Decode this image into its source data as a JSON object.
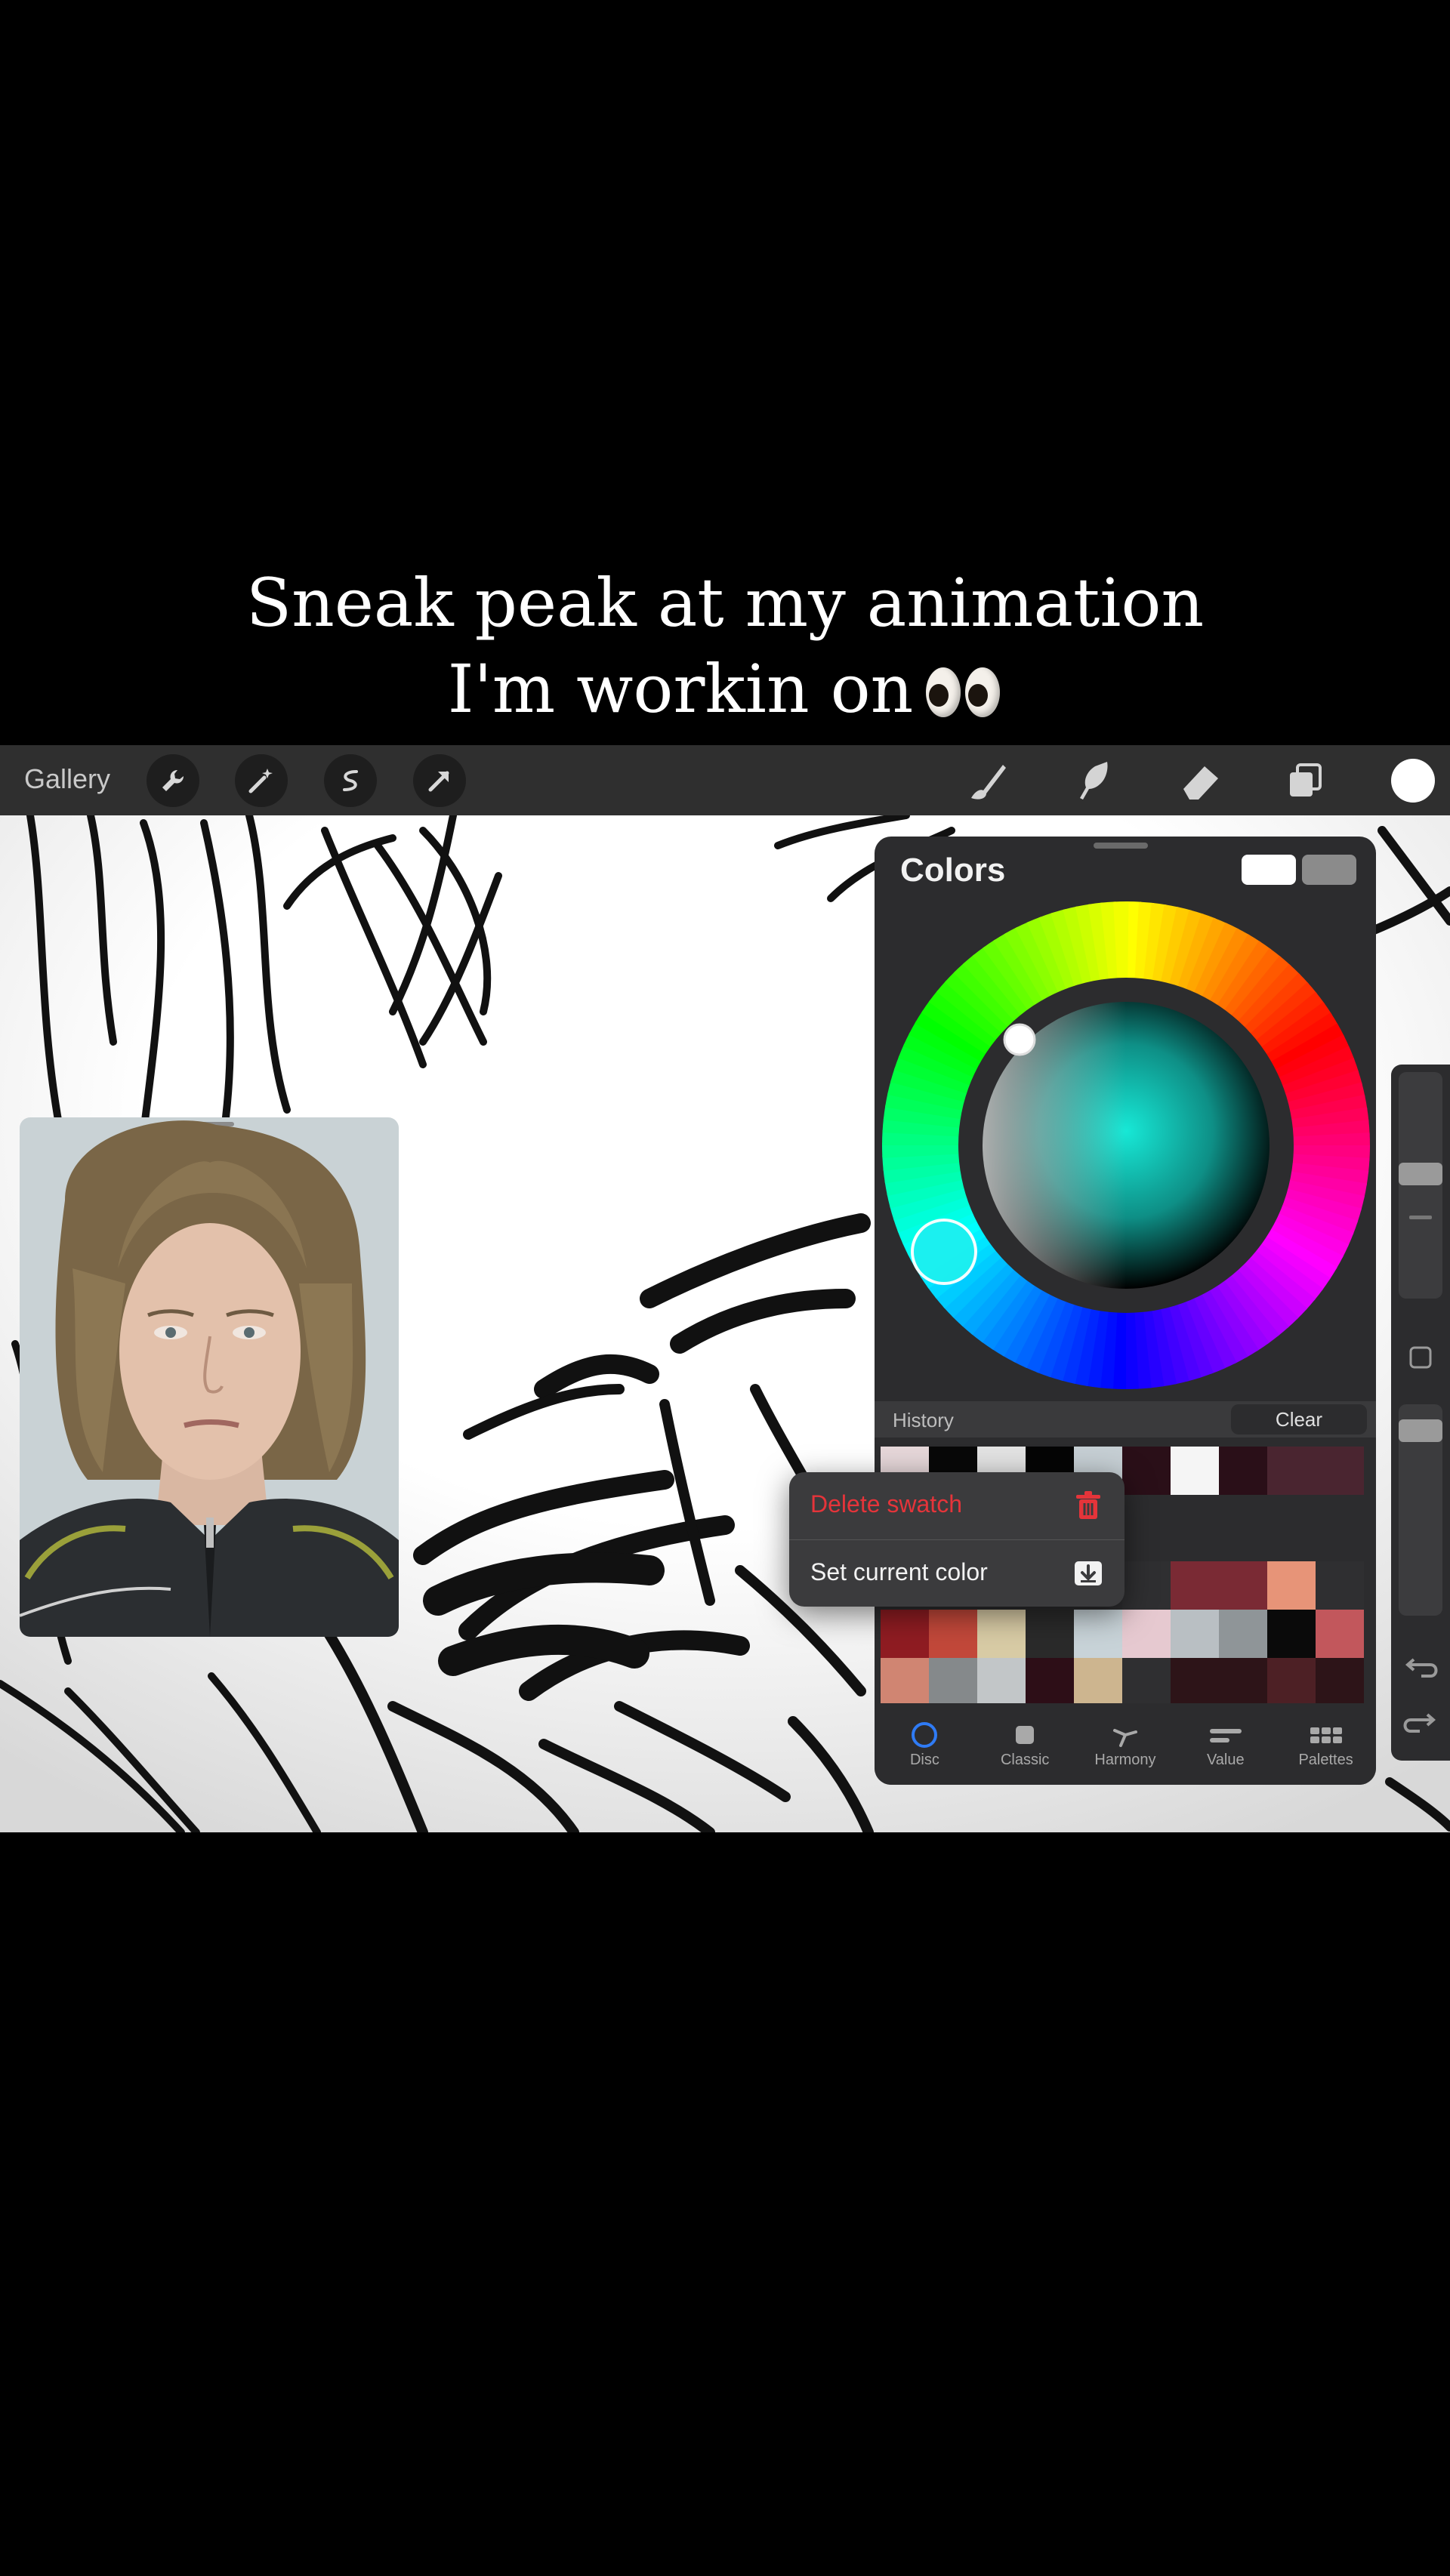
{
  "caption": {
    "line1": "Sneak peak at my animation",
    "line2": "I'm workin on"
  },
  "toolbar": {
    "gallery_label": "Gallery",
    "left_icons": [
      "wrench-icon",
      "magic-wand-icon",
      "selection-icon",
      "arrow-transform-icon"
    ],
    "right_icons": [
      "brush-icon",
      "smudge-icon",
      "eraser-icon",
      "layers-icon"
    ],
    "current_color": "#ffffff"
  },
  "colors_panel": {
    "title": "Colors",
    "current_swatch": "#ffffff",
    "previous_swatch": "#8b8b8b",
    "selected_hue": "#17e8d6",
    "history_label": "History",
    "clear_label": "Clear",
    "history_colors": [
      "#e6d7d9",
      "#080808",
      "#e3e3e3",
      "#050505",
      "#c6cfd4",
      "#2a0f18",
      "#f5f5f5",
      "#2a0f18",
      "#4a2530",
      "#4a2530"
    ],
    "palette_colors": [
      "#2c2c2e",
      "#2c2c2e",
      "#2c2c2e",
      "#2c2c2e",
      "#2c2c2e",
      "#2f2f31",
      "#7a2a34",
      "#7a2a34",
      "#e79478",
      "#2f2f31",
      "#8f1c22",
      "#c2483a",
      "#d8cba5",
      "#2a2a2a",
      "#c8d3d8",
      "#e6c9d0",
      "#b9bfc3",
      "#8f9598",
      "#0a0a0a",
      "#c2575c",
      "#d08572",
      "#85898b",
      "#c2c6c8",
      "#2d0e17",
      "#cdb58f",
      "#2f2f31",
      "#2d1418",
      "#2d1418",
      "#4d2025",
      "#2d1418"
    ],
    "tabs": [
      {
        "label": "Disc",
        "icon": "disc-icon"
      },
      {
        "label": "Classic",
        "icon": "classic-icon"
      },
      {
        "label": "Harmony",
        "icon": "harmony-icon"
      },
      {
        "label": "Value",
        "icon": "value-icon"
      },
      {
        "label": "Palettes",
        "icon": "palettes-icon"
      }
    ]
  },
  "context_menu": {
    "delete_label": "Delete swatch",
    "delete_color": "#e5343a",
    "set_label": "Set current color"
  }
}
